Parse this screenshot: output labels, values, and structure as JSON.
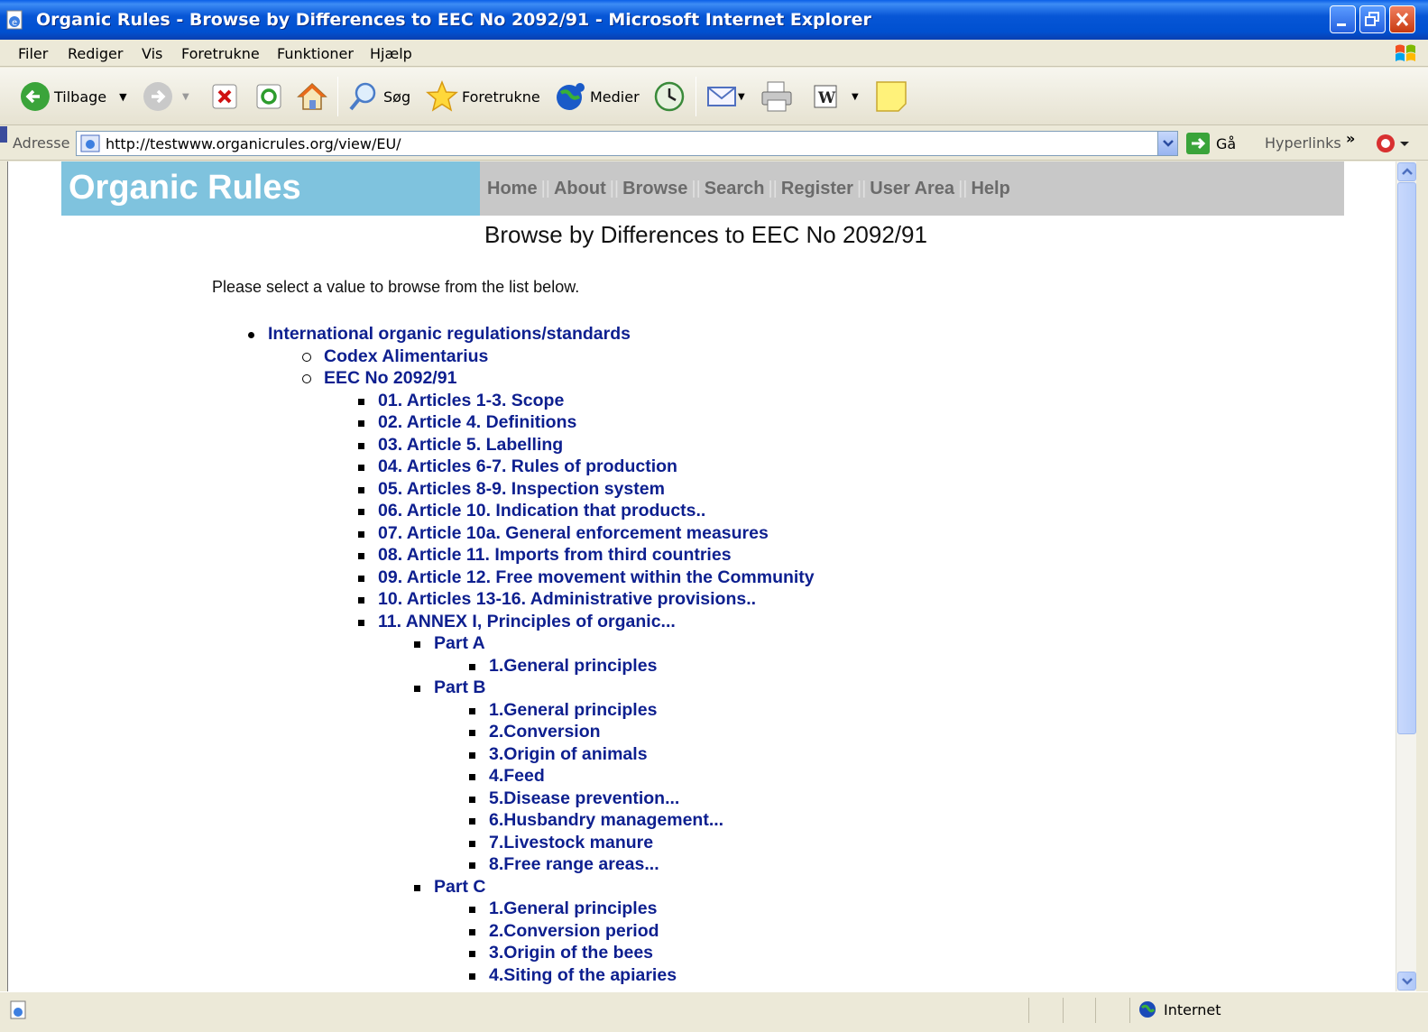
{
  "window": {
    "title": "Organic Rules - Browse by Differences to EEC No 2092/91 - Microsoft Internet Explorer"
  },
  "menu": [
    "Filer",
    "Rediger",
    "Vis",
    "Foretrukne",
    "Funktioner",
    "Hjælp"
  ],
  "toolbar": {
    "back": "Tilbage",
    "search": "Søg",
    "favorites": "Foretrukne",
    "media": "Medier"
  },
  "address": {
    "label": "Adresse",
    "url": "http://testwww.organicrules.org/view/EU/",
    "go": "Gå",
    "links": "Hyperlinks"
  },
  "site": {
    "brand": "Organic Rules",
    "nav": [
      "Home",
      "About",
      "Browse",
      "Search",
      "Register",
      "User Area",
      "Help"
    ]
  },
  "page": {
    "title": "Browse by Differences to EEC No 2092/91",
    "intro": "Please select a value to browse from the list below."
  },
  "tree": [
    {
      "level": 1,
      "label": "International organic regulations/standards"
    },
    {
      "level": 2,
      "label": "Codex Alimentarius"
    },
    {
      "level": 2,
      "label": "EEC No 2092/91"
    },
    {
      "level": 3,
      "label": "01. Articles 1-3. Scope"
    },
    {
      "level": 3,
      "label": "02. Article 4. Definitions"
    },
    {
      "level": 3,
      "label": "03. Article 5. Labelling"
    },
    {
      "level": 3,
      "label": "04. Articles 6-7. Rules of production"
    },
    {
      "level": 3,
      "label": "05. Articles 8-9. Inspection system"
    },
    {
      "level": 3,
      "label": "06. Article 10. Indication that products.."
    },
    {
      "level": 3,
      "label": "07. Article 10a. General enforcement measures"
    },
    {
      "level": 3,
      "label": "08. Article 11. Imports from third countries"
    },
    {
      "level": 3,
      "label": "09. Article 12. Free movement within the Community"
    },
    {
      "level": 3,
      "label": "10. Articles 13-16. Administrative provisions.."
    },
    {
      "level": 3,
      "label": "11. ANNEX I, Principles of organic..."
    },
    {
      "level": 4,
      "label": "Part A"
    },
    {
      "level": 5,
      "label": "1.General principles"
    },
    {
      "level": 4,
      "label": "Part B"
    },
    {
      "level": 5,
      "label": "1.General principles"
    },
    {
      "level": 5,
      "label": "2.Conversion"
    },
    {
      "level": 5,
      "label": "3.Origin of animals"
    },
    {
      "level": 5,
      "label": "4.Feed"
    },
    {
      "level": 5,
      "label": "5.Disease prevention..."
    },
    {
      "level": 5,
      "label": "6.Husbandry management..."
    },
    {
      "level": 5,
      "label": "7.Livestock manure"
    },
    {
      "level": 5,
      "label": "8.Free range areas..."
    },
    {
      "level": 4,
      "label": "Part C"
    },
    {
      "level": 5,
      "label": "1.General principles"
    },
    {
      "level": 5,
      "label": "2.Conversion period"
    },
    {
      "level": 5,
      "label": "3.Origin of the bees"
    },
    {
      "level": 5,
      "label": "4.Siting of the apiaries"
    }
  ],
  "status": {
    "zone": "Internet"
  },
  "colors": {
    "link": "#0d1f8f",
    "brand_bg": "#7fc3de",
    "nav_bg": "#c8c8c8"
  }
}
